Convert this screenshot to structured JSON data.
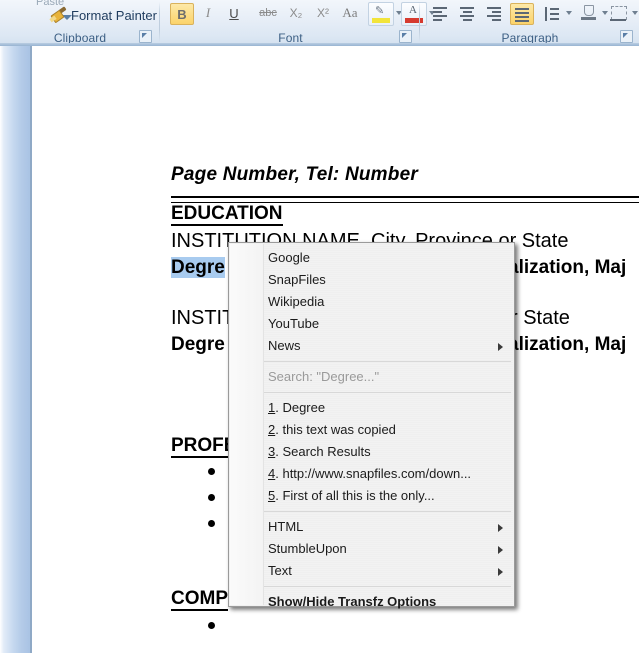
{
  "ribbon": {
    "groups": [
      {
        "name": "clipboard",
        "label": "Clipboard"
      },
      {
        "name": "font",
        "label": "Font"
      },
      {
        "name": "paragraph",
        "label": "Paragraph"
      }
    ],
    "clipboard": {
      "paste_label": "Paste",
      "format_painter_label": "Format Painter",
      "paste_arrow_icon": "chevron-down-icon",
      "format_painter_icon": "paintbrush-icon",
      "dialog_launcher_icon": "dialog-launcher-icon"
    },
    "font": {
      "bold_label": "B",
      "italic_label": "I",
      "underline_label": "U",
      "strikethrough_label": "abc",
      "subscript_label": "X₂",
      "superscript_label": "X²",
      "change_case_label": "Aa",
      "highlight_icon": "text-highlight-icon",
      "highlight_color": "#f2e43a",
      "fontcolor_label": "A",
      "fontcolor_icon": "font-color-icon",
      "fontcolor_color": "#d63a2f"
    },
    "paragraph": {
      "align_left_icon": "align-left-icon",
      "align_center_icon": "align-center-icon",
      "align_right_icon": "align-right-icon",
      "align_justify_icon": "align-justify-icon",
      "line_spacing_icon": "line-spacing-icon",
      "shading_icon": "shading-icon",
      "borders_icon": "borders-icon"
    }
  },
  "document": {
    "header_text": "Page Number, Tel:  Number",
    "sections": [
      {
        "heading": "EDUCATION",
        "entries": [
          {
            "institution": "INSTITUTION NAME, City, Province or State",
            "degree_prefix": "Degre",
            "degree_suffix": "alization, Maj"
          },
          {
            "institution": "INSTIT",
            "institution_tail": "r State",
            "degree_prefix": "Degre",
            "degree_suffix": "alization, Maj"
          }
        ]
      },
      {
        "heading": "PROFE",
        "bullets": 3
      },
      {
        "heading": "COMP",
        "bullets": 1
      }
    ],
    "selected_text": "Degre"
  },
  "context_menu": {
    "search_providers": [
      {
        "label": "Google",
        "submenu": false
      },
      {
        "label": "SnapFiles",
        "submenu": false
      },
      {
        "label": "Wikipedia",
        "submenu": false
      },
      {
        "label": "YouTube",
        "submenu": false
      },
      {
        "label": "News",
        "submenu": true
      }
    ],
    "search_header": "Search: \"Degree...\"",
    "history": [
      {
        "num": "1",
        "label": ". Degree"
      },
      {
        "num": "2",
        "label": ". this text was copied"
      },
      {
        "num": "3",
        "label": ". Search Results"
      },
      {
        "num": "4",
        "label": ". http://www.snapfiles.com/down..."
      },
      {
        "num": "5",
        "label": ". First of all this is the only..."
      }
    ],
    "tools": [
      {
        "label": "HTML",
        "submenu": true
      },
      {
        "label": "StumbleUpon",
        "submenu": true
      },
      {
        "label": "Text",
        "submenu": true
      }
    ],
    "footer": "Show/Hide Transfz Options"
  }
}
